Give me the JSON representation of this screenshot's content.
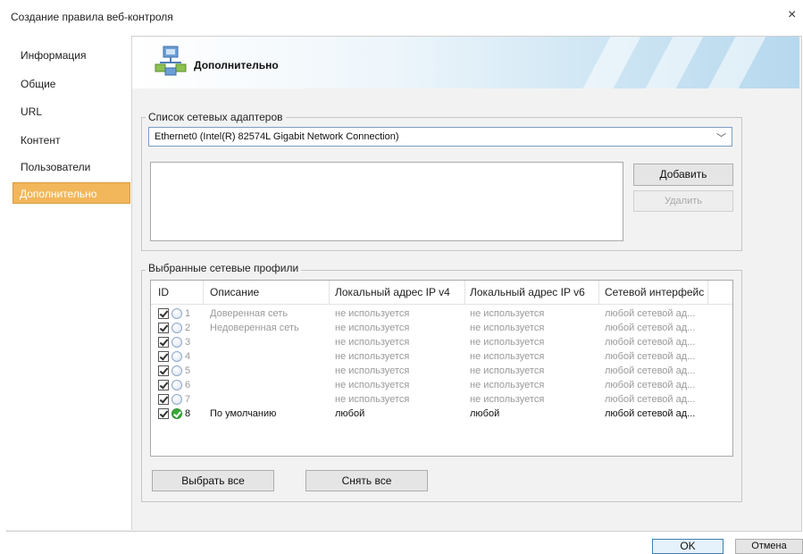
{
  "window": {
    "title": "Создание правила веб-контроля",
    "close_label": "×"
  },
  "nav": {
    "items": [
      {
        "label": "Информация",
        "active": false
      },
      {
        "label": "Общие",
        "active": false
      },
      {
        "label": "URL",
        "active": false
      },
      {
        "label": "Контент",
        "active": false
      },
      {
        "label": "Пользователи",
        "active": false
      },
      {
        "label": "Дополнительно",
        "active": true
      }
    ]
  },
  "header": {
    "title": "Дополнительно",
    "icon": "network-icon"
  },
  "adapters": {
    "group_label": "Список сетевых адаптеров",
    "selected": "Ethernet0 (Intel(R) 82574L Gigabit Network Connection)",
    "chevron": "﹀",
    "add_label": "Добавить",
    "remove_label": "Удалить"
  },
  "profiles": {
    "group_label": "Выбранные сетевые профили",
    "columns": [
      "ID",
      "Описание",
      "Локальный адрес IP v4",
      "Локальный адрес IP v6",
      "Сетевой интерфейс"
    ],
    "rows": [
      {
        "id": "1",
        "desc": "Доверенная сеть",
        "ipv4": "не используется",
        "ipv6": "не используется",
        "iface": "любой сетевой ад...",
        "checked": true,
        "active": false
      },
      {
        "id": "2",
        "desc": "Недоверенная сеть",
        "ipv4": "не используется",
        "ipv6": "не используется",
        "iface": "любой сетевой ад...",
        "checked": true,
        "active": false
      },
      {
        "id": "3",
        "desc": "",
        "ipv4": "не используется",
        "ipv6": "не используется",
        "iface": "любой сетевой ад...",
        "checked": true,
        "active": false
      },
      {
        "id": "4",
        "desc": "",
        "ipv4": "не используется",
        "ipv6": "не используется",
        "iface": "любой сетевой ад...",
        "checked": true,
        "active": false
      },
      {
        "id": "5",
        "desc": "",
        "ipv4": "не используется",
        "ipv6": "не используется",
        "iface": "любой сетевой ад...",
        "checked": true,
        "active": false
      },
      {
        "id": "6",
        "desc": "",
        "ipv4": "не используется",
        "ipv6": "не используется",
        "iface": "любой сетевой ад...",
        "checked": true,
        "active": false
      },
      {
        "id": "7",
        "desc": "",
        "ipv4": "не используется",
        "ipv6": "не используется",
        "iface": "любой сетевой ад...",
        "checked": true,
        "active": false
      },
      {
        "id": "8",
        "desc": "По умолчанию",
        "ipv4": "любой",
        "ipv6": "любой",
        "iface": "любой сетевой ад...",
        "checked": true,
        "active": true
      }
    ],
    "select_all_label": "Выбрать все",
    "clear_all_label": "Снять все"
  },
  "footer": {
    "ok_label": "OK",
    "cancel_label": "Отмена"
  },
  "colors": {
    "accent": "#f2b75a",
    "banner": "#b6d8ee",
    "ok_border": "#3c7fb1"
  }
}
